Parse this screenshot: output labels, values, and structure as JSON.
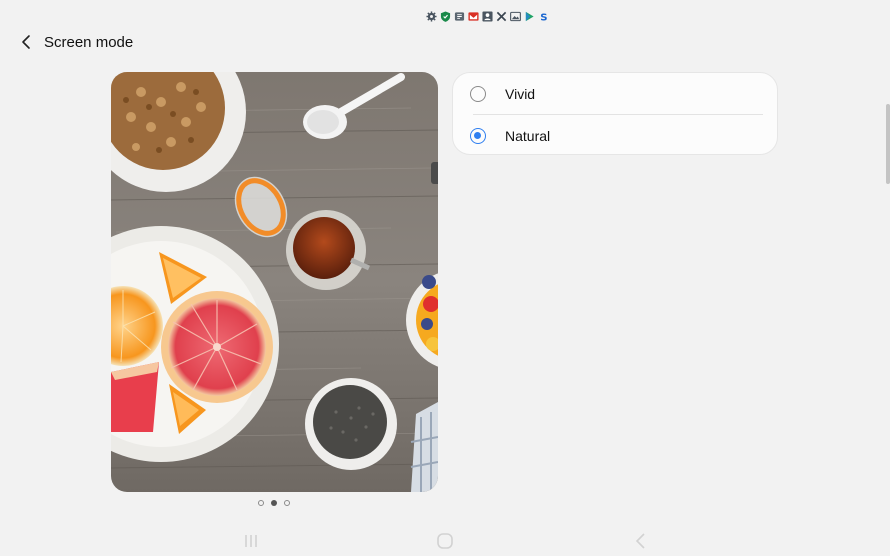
{
  "status_bar": {
    "icons": [
      "gear-icon",
      "shield-icon",
      "shield-outline-icon",
      "gmail-icon",
      "image-person-icon",
      "tools-icon",
      "gallery-icon",
      "play-store-icon",
      "samsung-pay-icon"
    ]
  },
  "header": {
    "title": "Screen mode",
    "back_icon": "chevron-left-icon"
  },
  "preview": {
    "image": "food-table-photo",
    "pages": 3,
    "active_page": 2
  },
  "options": [
    {
      "label": "Vivid",
      "selected": false
    },
    {
      "label": "Natural",
      "selected": true
    }
  ],
  "navigation_bar": {
    "icons": [
      "recent-apps-icon",
      "home-icon",
      "back-icon"
    ]
  },
  "colors": {
    "background": "#f2f2f2",
    "card": "#fcfcfc",
    "accent": "#2f7ff0"
  }
}
